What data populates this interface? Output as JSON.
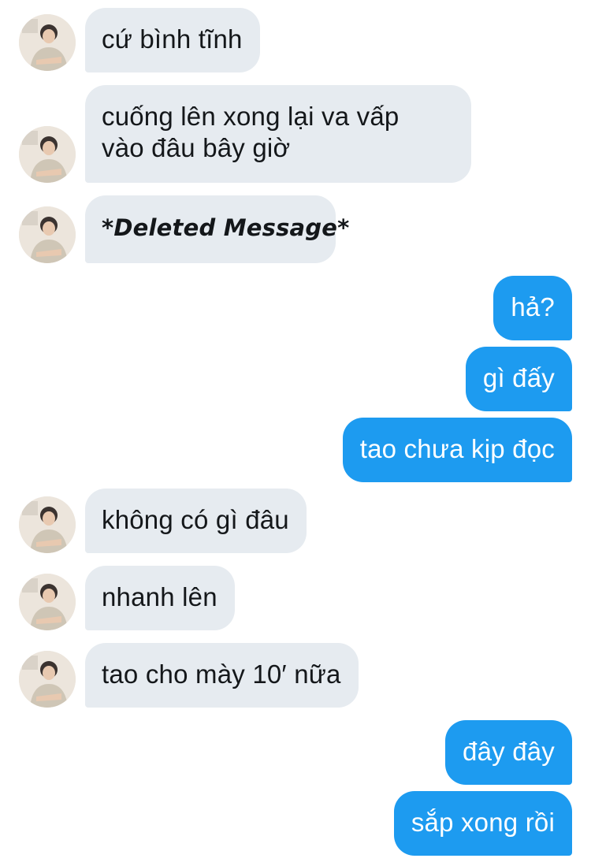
{
  "conversation": {
    "messages": [
      {
        "side": "in",
        "text": "cứ bình tĩnh"
      },
      {
        "side": "in",
        "lines": [
          "cuống lên xong lại va vấp",
          "vào đâu bây giờ"
        ]
      },
      {
        "side": "in",
        "text": "*Deleted Message*",
        "deleted": true
      },
      {
        "side": "out",
        "text": "hả?"
      },
      {
        "side": "out",
        "text": "gì đấy"
      },
      {
        "side": "out",
        "text": "tao chưa kịp đọc"
      },
      {
        "side": "in",
        "text": "không có gì đâu"
      },
      {
        "side": "in",
        "text": "nhanh lên"
      },
      {
        "side": "in",
        "text": "tao cho mày 10′ nữa"
      },
      {
        "side": "out",
        "text": "đây đây"
      },
      {
        "side": "out",
        "text": "sắp xong rồi"
      }
    ]
  },
  "colors": {
    "incoming_bubble": "#e6ebf0",
    "outgoing_bubble": "#1d9bf0",
    "incoming_text": "#14171a",
    "outgoing_text": "#ffffff"
  },
  "icons": {
    "avatar": "profile-photo-avatar"
  }
}
